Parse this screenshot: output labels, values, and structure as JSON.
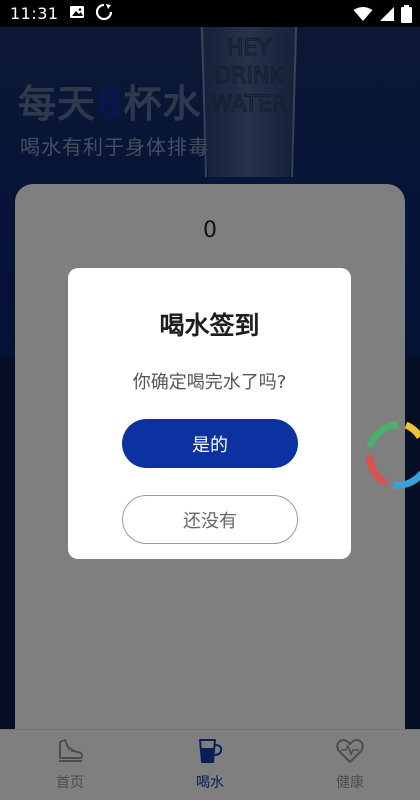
{
  "status_bar": {
    "time": "11:31",
    "icons": [
      "image-notification-icon",
      "sync-notification-icon",
      "wifi-icon",
      "cellular-signal-icon",
      "battery-icon"
    ]
  },
  "hero": {
    "title_prefix": "每天",
    "title_highlight": "8",
    "title_suffix": "杯水",
    "subtitle": "喝水有利于身体排毒",
    "glass_text": [
      "HEY",
      "DRINK",
      "WATER"
    ]
  },
  "card": {
    "count": "0"
  },
  "dialog": {
    "title": "喝水签到",
    "message": "你确定喝完水了吗?",
    "confirm_label": "是的",
    "cancel_label": "还没有"
  },
  "nav": {
    "items": [
      {
        "label": "首页",
        "icon": "running-shoe-icon",
        "active": false
      },
      {
        "label": "喝水",
        "icon": "water-cup-icon",
        "active": true
      },
      {
        "label": "健康",
        "icon": "heart-pulse-icon",
        "active": false
      }
    ]
  },
  "colors": {
    "primary": "#0b32a0",
    "hero_bg": "#0f2a6e",
    "active_nav": "#1540a8",
    "inactive_nav": "#9a9a9a",
    "overlay": "rgba(0,0,0,0.5)"
  }
}
